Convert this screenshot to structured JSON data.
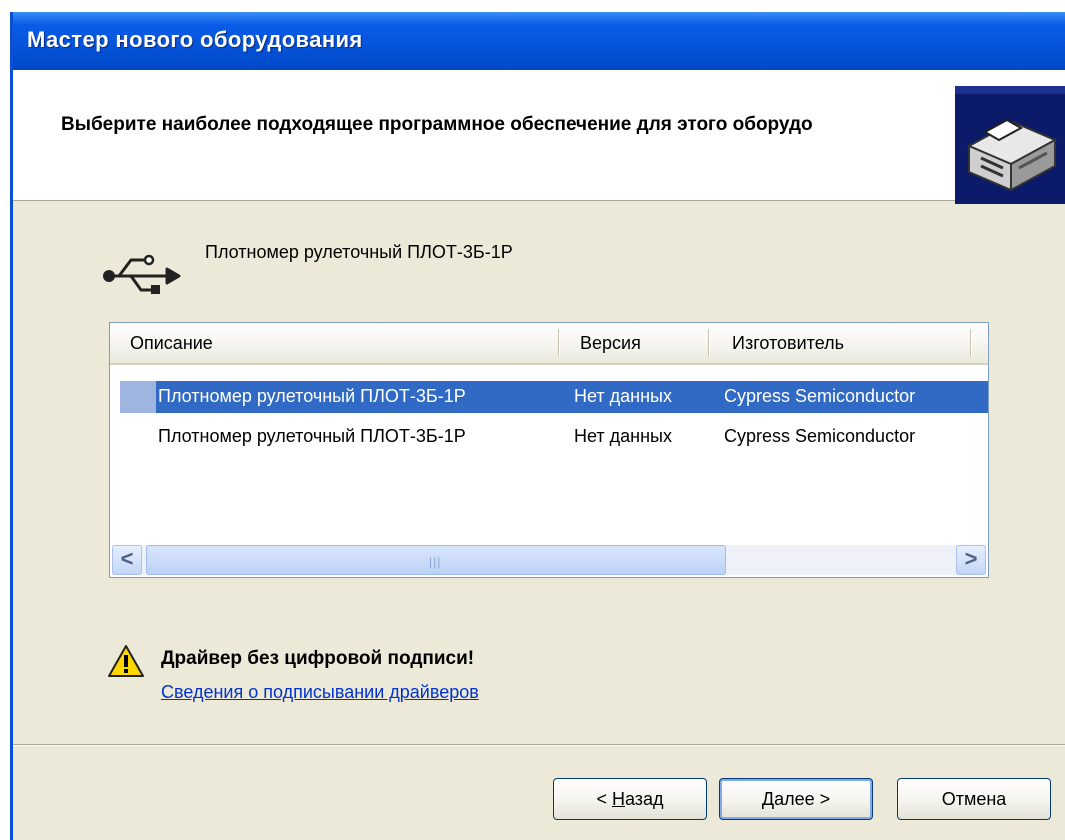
{
  "window": {
    "title": "Мастер нового оборудования"
  },
  "header": {
    "title": "Выберите наиболее подходящее программное обеспечение для этого оборудо",
    "icon": "hardware-icon"
  },
  "device": {
    "icon": "usb-icon",
    "name": "Плотномер рулеточный ПЛОТ-3Б-1Р"
  },
  "list": {
    "columns": [
      "Описание",
      "Версия",
      "Изготовитель"
    ],
    "rows": [
      {
        "description": "Плотномер рулеточный ПЛОТ-3Б-1Р",
        "version": "Нет данных",
        "manufacturer": "Cypress Semiconductor",
        "selected": true
      },
      {
        "description": "Плотномер рулеточный ПЛОТ-3Б-1Р",
        "version": "Нет данных",
        "manufacturer": "Cypress Semiconductor",
        "selected": false
      }
    ],
    "scroll_left": "<",
    "scroll_right": ">"
  },
  "warning": {
    "icon": "warning-icon",
    "text": "Драйвер без цифровой подписи!",
    "link": "Сведения о подписывании драйверов"
  },
  "buttons": {
    "back": {
      "prefix": "< ",
      "hotkey": "Н",
      "rest": "азад"
    },
    "next": {
      "hotkey": "Д",
      "rest": "алее",
      "suffix": " >"
    },
    "cancel": "Отмена"
  },
  "colors": {
    "titlebar": "#0553d8",
    "selection": "#316ac5",
    "link": "#0033cc"
  }
}
